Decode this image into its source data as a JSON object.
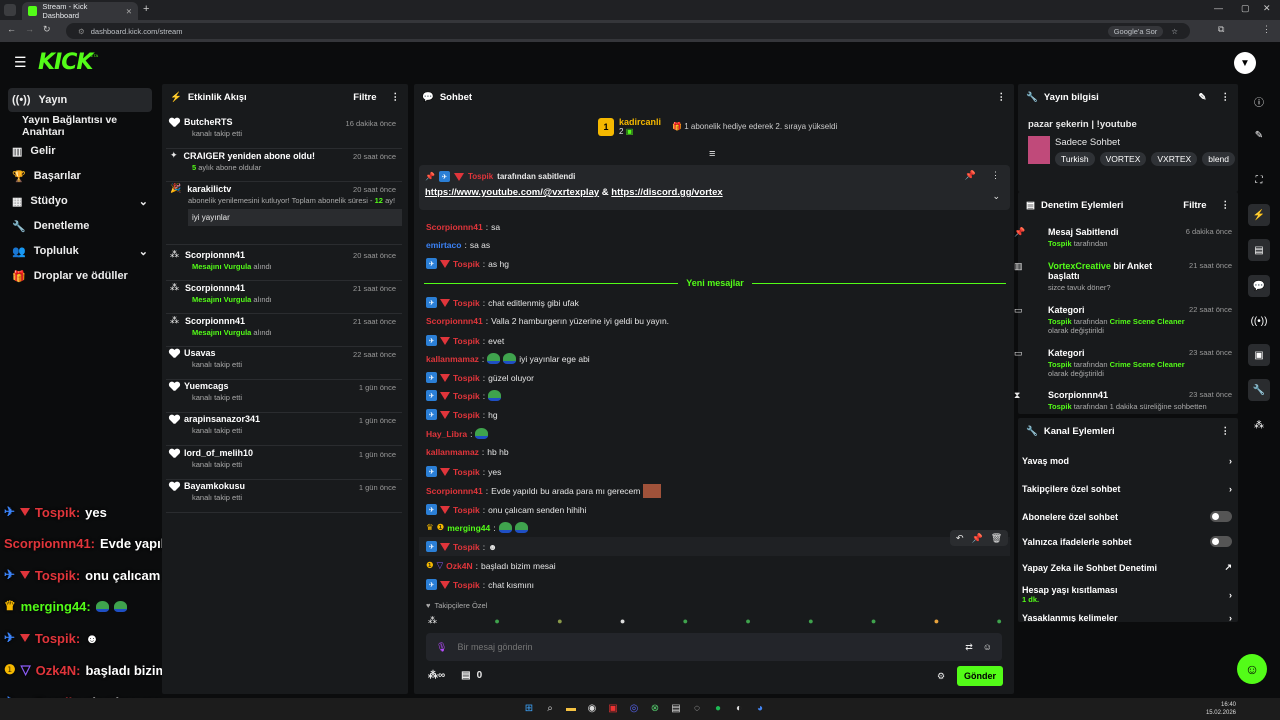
{
  "browser": {
    "tab_title": "Stream - Kick Dashboard",
    "url_text": "dashboard.kick.com/stream",
    "translate_label": "Google'a Sor"
  },
  "site": {
    "logo": "KICK",
    "logo_beta": "BETA"
  },
  "nav": {
    "items": [
      {
        "label": "Yayın"
      },
      {
        "label": "Yayın Bağlantısı ve Anahtarı"
      },
      {
        "label": "Gelir"
      },
      {
        "label": "Başarılar"
      },
      {
        "label": "Stüdyo"
      },
      {
        "label": "Denetleme"
      },
      {
        "label": "Topluluk"
      },
      {
        "label": "Droplar ve ödüller"
      }
    ]
  },
  "activity": {
    "title": "Etkinlik Akışı",
    "filter": "Filtre",
    "items": [
      {
        "name": "ButcheRTS",
        "sub": "kanalı takip etti",
        "time": "16 dakika önce"
      },
      {
        "name": "CRAIGER yeniden abone oldu!",
        "sub_hl": "5",
        "sub": "aylık abone oldular",
        "time": "20 saat önce"
      },
      {
        "name": "karakilictv",
        "sub": "abonelik yenilemesini kutluyor! Toplam abonelik süresi -",
        "sub_hl": "12",
        "sub2": "ay!",
        "quote": "iyi yayınlar",
        "time": "20 saat önce"
      },
      {
        "name": "Scorpionnn41",
        "sub_hl": "Mesajını Vurgula",
        "sub": "alındı",
        "time": "20 saat önce"
      },
      {
        "name": "Scorpionnn41",
        "sub_hl": "Mesajını Vurgula",
        "sub": "alındı",
        "time": "21 saat önce"
      },
      {
        "name": "Scorpionnn41",
        "sub_hl": "Mesajını Vurgula",
        "sub": "alındı",
        "time": "21 saat önce"
      },
      {
        "name": "Usavas",
        "sub": "kanalı takip etti",
        "time": "22 saat önce"
      },
      {
        "name": "Yuemcags",
        "sub": "kanalı takip etti",
        "time": "1 gün önce"
      },
      {
        "name": "arapinsanazor341",
        "sub": "kanalı takip etti",
        "time": "1 gün önce"
      },
      {
        "name": "lord_of_melih10",
        "sub": "kanalı takip etti",
        "time": "1 gün önce"
      },
      {
        "name": "Bayamkokusu",
        "sub": "kanalı takip etti",
        "time": "1 gün önce"
      }
    ]
  },
  "chat": {
    "title": "Sohbet",
    "gift_user": "kadircanli",
    "gift_rank": "1",
    "gift_count": "2",
    "gift_text": "1 abonelik hediye ederek 2. sıraya yükseldi",
    "pinned_by": "Tospik",
    "pinned_label": "tarafından sabitlendi",
    "pinned_link1": "https://www.youtube.com/@vxrtexplay",
    "pinned_amp": "&",
    "pinned_link2": "https://discord.gg/vortex",
    "new_label": "Yeni mesajlar",
    "followers_only": "Takipçilere Özel",
    "placeholder": "Bir mesaj gönderin",
    "send": "Gönder",
    "points": "0",
    "messages": [
      {
        "user": "Scorpionnn41",
        "text": "sa",
        "color": "red"
      },
      {
        "user": "emirtaco",
        "text": "sa as",
        "color": "blu"
      },
      {
        "user": "Tospik",
        "text": "as hg",
        "color": "red",
        "badge": true
      },
      {
        "user": "Tospik",
        "text": "chat editlenmiş gibi ufak",
        "color": "red",
        "badge": true
      },
      {
        "user": "Scorpionnn41",
        "text": "Valla 2 hamburgerın yüzerine iyi geldi bu yayın.",
        "color": "red"
      },
      {
        "user": "Tospik",
        "text": "evet",
        "color": "red",
        "badge": true
      },
      {
        "user": "kallanmamaz",
        "text": "iyi yayınlar ege abi",
        "color": "red",
        "emotes": 2
      },
      {
        "user": "Tospik",
        "text": "güzel oluyor",
        "color": "red",
        "badge": true
      },
      {
        "user": "Tospik",
        "text": "",
        "color": "red",
        "badge": true,
        "emotes": 1
      },
      {
        "user": "Tospik",
        "text": "hg",
        "color": "red",
        "badge": true
      },
      {
        "user": "Hay_Libra",
        "text": "",
        "color": "red",
        "emotes": 1
      },
      {
        "user": "kallanmamaz",
        "text": "hb hb",
        "color": "red"
      },
      {
        "user": "Tospik",
        "text": "yes",
        "color": "red",
        "badge": true
      },
      {
        "user": "Scorpionnn41",
        "text": "Evde yapıldı bu arada para mı gerecem",
        "color": "red"
      },
      {
        "user": "Tospik",
        "text": "onu çalıcam senden hihihi",
        "color": "red",
        "badge": true
      },
      {
        "user": "merging44",
        "text": "",
        "color": "grn",
        "emotes": 2
      },
      {
        "user": "Tospik",
        "text": "",
        "color": "red",
        "badge": true
      },
      {
        "user": "Ozk4N",
        "text": "başladı bizim mesai",
        "color": "red"
      },
      {
        "user": "Tospik",
        "text": "chat kısmını",
        "color": "red",
        "badge": true
      }
    ]
  },
  "overlay": [
    {
      "user": "Tospik:",
      "text": "yes"
    },
    {
      "user": "Scorpionnn41:",
      "text": "Evde yapıldı bu arada para mı gerecem"
    },
    {
      "user": "Tospik:",
      "text": "onu çalıcam senden hihihi"
    },
    {
      "user": "merging44:",
      "text": ""
    },
    {
      "user": "Tospik:",
      "text": ""
    },
    {
      "user": "Ozk4N:",
      "text": "başladı bizim mesai"
    },
    {
      "user": "Tospik:",
      "text": "chat kısmını"
    }
  ],
  "stream_info": {
    "title": "Yayın bilgisi",
    "stream_title": "pazar şekerin | !youtube",
    "category": "Sadece Sohbet",
    "tags": [
      "Turkish",
      "VORTEX",
      "VXRTEX",
      "blend"
    ]
  },
  "mod_actions": {
    "title": "Denetim Eylemleri",
    "filter": "Filtre",
    "items": [
      {
        "title": "Mesaj Sabitlendi",
        "sub_hl": "Tospik",
        "sub": "tarafından",
        "time": "6 dakika önce"
      },
      {
        "title_hl": "VortexCreative",
        "title": "bir Anket başlattı",
        "sub": "sizce tavuk döner?",
        "time": "21 saat önce"
      },
      {
        "title": "Kategori",
        "sub_hl": "Tospik",
        "sub": "tarafından",
        "sub_hl2": "Crime Scene Cleaner",
        "sub2": "olarak değiştirildi",
        "time": "22 saat önce"
      },
      {
        "title": "Kategori",
        "sub_hl": "Tospik",
        "sub": "tarafından",
        "sub_hl2": "Crime Scene Cleaner",
        "sub2": "olarak değiştirildi",
        "time": "23 saat önce"
      },
      {
        "title": "Scorpionnn41",
        "sub_hl": "Tospik",
        "sub": "tarafından 1 dakika süreliğine sohbetten",
        "time": "23 saat önce"
      }
    ]
  },
  "channel_actions": {
    "title": "Kanal Eylemleri",
    "items": [
      {
        "label": "Yavaş mod"
      },
      {
        "label": "Takipçilere özel sohbet"
      },
      {
        "label": "Abonelere özel sohbet"
      },
      {
        "label": "Yalnızca ifadelerle sohbet"
      },
      {
        "label": "Yapay Zeka ile Sohbet Denetimi"
      },
      {
        "label": "Hesap yaşı kısıtlaması",
        "sub": "1 dk."
      },
      {
        "label": "Yasaklanmış kelimeler"
      }
    ]
  },
  "taskbar": {
    "time": "16:40",
    "date": "15.02.2026"
  }
}
